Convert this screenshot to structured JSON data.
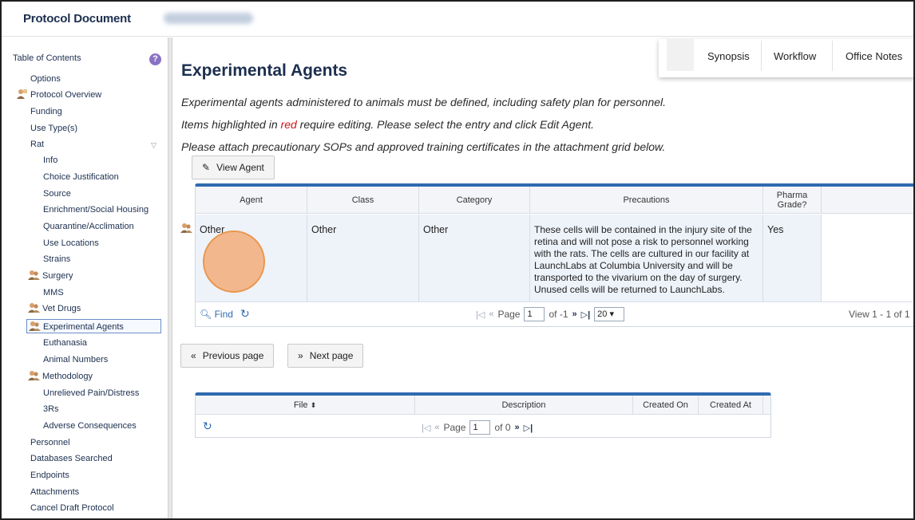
{
  "header": {
    "title": "Protocol Document",
    "doc_id": "2025-0020 1 Rat"
  },
  "sidebar": {
    "heading": "Table of Contents",
    "help_glyph": "?",
    "items": [
      {
        "label": "Options"
      },
      {
        "label": "Protocol Overview"
      },
      {
        "label": "Funding"
      },
      {
        "label": "Use Type(s)"
      },
      {
        "label": "Rat"
      },
      {
        "label": "Info"
      },
      {
        "label": "Choice Justification"
      },
      {
        "label": "Source"
      },
      {
        "label": "Enrichment/Social Housing"
      },
      {
        "label": "Quarantine/Acclimation"
      },
      {
        "label": "Use Locations"
      },
      {
        "label": "Strains"
      },
      {
        "label": "Surgery"
      },
      {
        "label": "MMS"
      },
      {
        "label": "Vet Drugs"
      },
      {
        "label": "Experimental Agents"
      },
      {
        "label": "Euthanasia"
      },
      {
        "label": "Animal Numbers"
      },
      {
        "label": "Methodology"
      },
      {
        "label": "Unrelieved Pain/Distress"
      },
      {
        "label": "3Rs"
      },
      {
        "label": "Adverse Consequences"
      },
      {
        "label": "Personnel"
      },
      {
        "label": "Databases Searched"
      },
      {
        "label": "Endpoints"
      },
      {
        "label": "Attachments"
      },
      {
        "label": "Cancel Draft Protocol"
      }
    ]
  },
  "tabs": {
    "synopsis": "Synopsis",
    "workflow": "Workflow",
    "office_notes": "Office Notes"
  },
  "main": {
    "title": "Experimental Agents",
    "instruction1": "Experimental agents administered to animals must be defined, including safety plan for personnel.",
    "instruction2_a": "Items highlighted in ",
    "instruction2_red": "red",
    "instruction2_b": " require editing. Please select the entry and click Edit Agent.",
    "instruction3": "Please attach precautionary SOPs and approved training certificates in the attachment grid below.",
    "view_agent_label": "View Agent",
    "prev_label": "Previous page",
    "next_label": "Next page"
  },
  "agents_grid": {
    "columns": [
      "Agent",
      "Class",
      "Category",
      "Precautions",
      "Pharma Grade?"
    ],
    "rows": [
      {
        "agent": "Other",
        "class": "Other",
        "category": "Other",
        "precautions": "These cells will be contained in the injury site of the retina and will not pose a risk to personnel working with the rats. The cells are cultured in our facility at LaunchLabs at Columbia University and will be transported to the vivarium on the day of surgery. Unused cells will be returned to LaunchLabs.",
        "pharma_grade": "Yes"
      }
    ],
    "find_label": "Find",
    "page_label": "Page",
    "page_value": "1",
    "of_label": "of -1",
    "page_size": "20",
    "view_label": "View 1 - 1 of 1"
  },
  "attach_grid": {
    "columns": [
      "File",
      "Description",
      "Created On",
      "Created At"
    ],
    "sort_glyph": "⬍",
    "page_label": "Page",
    "page_value": "1",
    "of_label": "of 0"
  },
  "colors": {
    "accent": "#2f6ab0",
    "title": "#1c2f4f",
    "highlight_red": "#d0141a"
  }
}
